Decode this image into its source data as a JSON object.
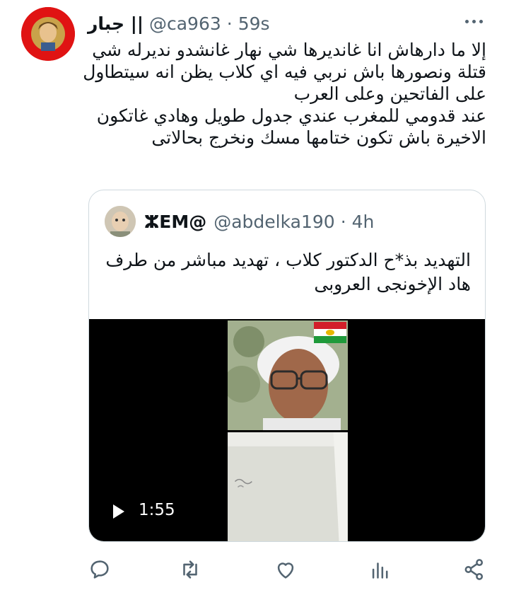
{
  "tweet": {
    "author_name": "جبار ||",
    "handle": "@ca963",
    "separator": "·",
    "time": "59s",
    "text_lines": [
      "إلا ما دارهاش انا غانديرها شي نهار غانشدو نديرله شي",
      "قتلة ونصورها باش نربي فيه اي كلاب يظن انه سيتطاول",
      "على الفاتحين وعلى العرب",
      "عند قدومي للمغرب عندي جدول طويل وهادي غاتكون",
      "الاخيرة باش تكون ختامها مسك ونخرج بحالاتى"
    ]
  },
  "quoted": {
    "author_name": "ⵣEM@",
    "handle": "@abdelka190",
    "separator": "·",
    "time": "4h",
    "text_lines": [
      "التهديد بذ*ح الدكتور كلاب ، تهديد مباشر من طرف",
      "هاد الإخونجى العروبى"
    ],
    "video_duration": "1:55"
  },
  "colors": {
    "secondary_text": "#536471",
    "border": "#cfd9de",
    "avatar_bg": "#e01313"
  },
  "actions": [
    "reply-icon",
    "retweet-icon",
    "like-icon",
    "views-icon",
    "share-icon"
  ]
}
